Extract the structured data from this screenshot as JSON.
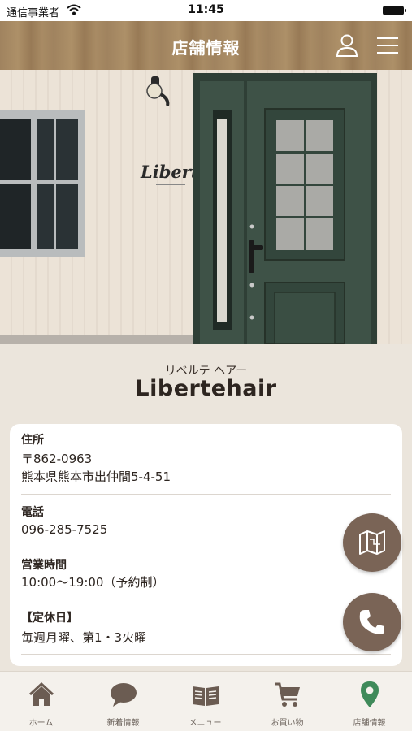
{
  "status_bar": {
    "carrier": "通信事業者",
    "time": "11:45"
  },
  "header": {
    "title": "店舗情報"
  },
  "hero": {
    "sign_text": "Liberte"
  },
  "shop": {
    "kana": "リベルテ ヘアー",
    "name": "Libertehair"
  },
  "info": {
    "address": {
      "label": "住所",
      "postal": "〒862-0963",
      "line": "熊本県熊本市出仲間5-4-51"
    },
    "phone": {
      "label": "電話",
      "value": "096-285-7525"
    },
    "hours": {
      "label": "営業時間",
      "value": "10:00〜19:00（予約制）"
    },
    "holiday": {
      "label": "【定休日】",
      "value": "毎週月曜、第1・3火曜"
    }
  },
  "fab": {
    "map_icon": "map-icon",
    "phone_icon": "phone-icon"
  },
  "nav": {
    "items": [
      {
        "label": "ホーム",
        "icon": "home-icon"
      },
      {
        "label": "新着情報",
        "icon": "chat-bubble-icon"
      },
      {
        "label": "メニュー",
        "icon": "book-icon"
      },
      {
        "label": "お買い物",
        "icon": "cart-icon"
      },
      {
        "label": "店舗情報",
        "icon": "location-pin-icon"
      }
    ],
    "active_index": 4
  },
  "colors": {
    "accent": "#3f8a5a",
    "fab": "#7a6456",
    "header": "#a0835f"
  }
}
